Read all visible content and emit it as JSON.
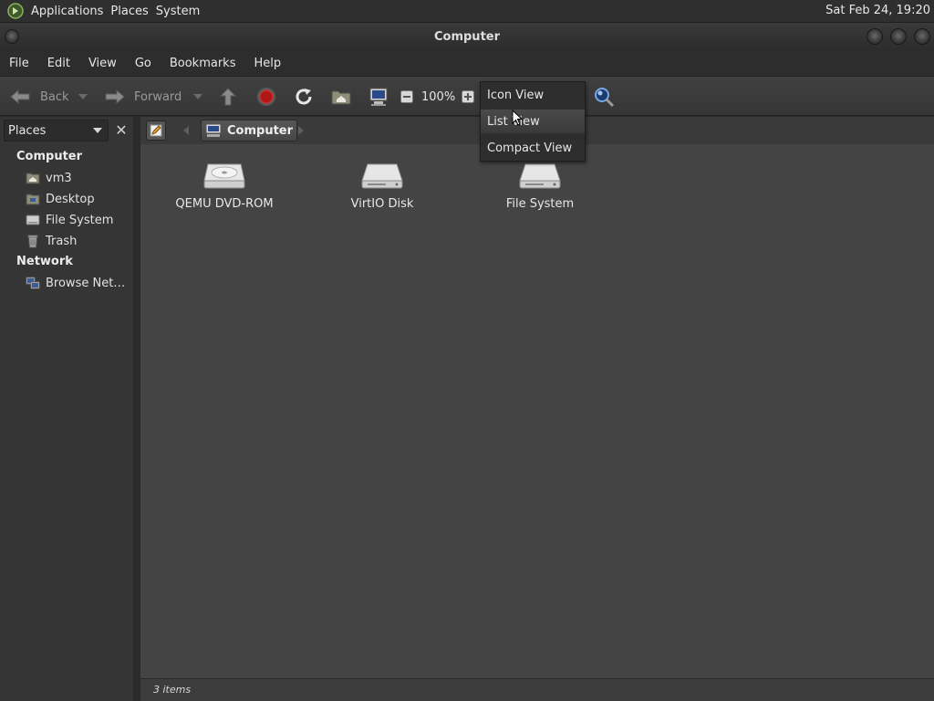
{
  "panel": {
    "menus": [
      "Applications",
      "Places",
      "System"
    ],
    "clock": "Sat Feb 24, 19:20"
  },
  "window": {
    "title": "Computer"
  },
  "menubar": [
    "File",
    "Edit",
    "View",
    "Go",
    "Bookmarks",
    "Help"
  ],
  "toolbar": {
    "back_label": "Back",
    "forward_label": "Forward",
    "zoom_level": "100%"
  },
  "view_menu": {
    "items": [
      "Icon View",
      "List View",
      "Compact View"
    ],
    "selected_index": 1
  },
  "location": {
    "crumb": "Computer"
  },
  "sidebar": {
    "selector_label": "Places",
    "sections": [
      {
        "heading": "Computer",
        "items": [
          {
            "label": "vm3",
            "icon": "home-folder-icon"
          },
          {
            "label": "Desktop",
            "icon": "desktop-folder-icon"
          },
          {
            "label": "File System",
            "icon": "drive-icon"
          },
          {
            "label": "Trash",
            "icon": "trash-icon"
          }
        ]
      },
      {
        "heading": "Network",
        "items": [
          {
            "label": "Browse Net…",
            "icon": "network-icon"
          }
        ]
      }
    ]
  },
  "content": {
    "items": [
      {
        "label": "QEMU DVD-ROM",
        "icon": "optical-drive-icon"
      },
      {
        "label": "VirtIO Disk",
        "icon": "hard-disk-icon"
      },
      {
        "label": "File System",
        "icon": "hard-disk-icon"
      }
    ]
  },
  "status": "3 items"
}
